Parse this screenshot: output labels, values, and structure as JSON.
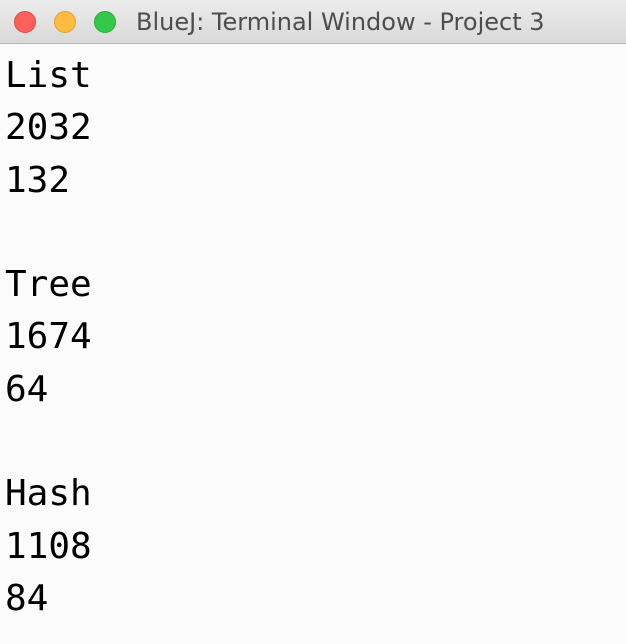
{
  "window": {
    "title": "BlueJ: Terminal Window - Project 3"
  },
  "traffic_lights": {
    "close_color": "#fc605c",
    "minimize_color": "#fdbc40",
    "zoom_color": "#34c84a"
  },
  "terminal": {
    "lines": [
      "List",
      "2032",
      "132",
      "",
      "Tree",
      "1674",
      "64",
      "",
      "Hash",
      "1108",
      "84"
    ]
  }
}
